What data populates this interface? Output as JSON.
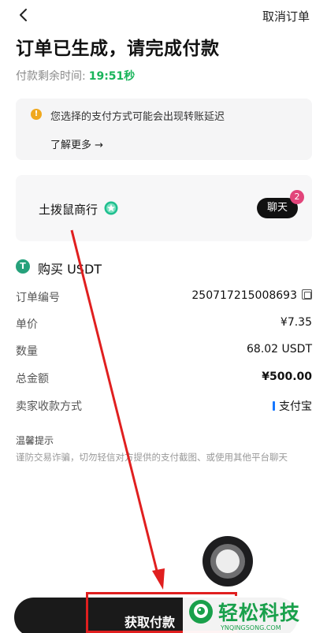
{
  "nav": {
    "cancel_label": "取消订单"
  },
  "header": {
    "title": "订单已生成，请完成付款",
    "timer_label": "付款剩余时间:",
    "timer_value": "19:51秒"
  },
  "notice": {
    "message": "您选择的支付方式可能会出现转账延迟",
    "link_label": "了解更多 →"
  },
  "seller": {
    "name": "土拨鼠商行",
    "chat_label": "聊天",
    "chat_badge": "2"
  },
  "order": {
    "heading": "购买 USDT",
    "coin_symbol": "T",
    "rows": [
      {
        "label": "订单编号",
        "value": "250717215008693"
      },
      {
        "label": "单价",
        "value": "¥7.35"
      },
      {
        "label": "数量",
        "value": "68.02 USDT"
      },
      {
        "label": "总金额",
        "value": "¥500.00"
      },
      {
        "label": "卖家收款方式",
        "value": "支付宝"
      }
    ]
  },
  "tips": {
    "title": "温馨提示",
    "text": "谨防交易诈骗，切勿轻信对方提供的支付截图、或使用其他平台聊天"
  },
  "action": {
    "button_label": "获取付款"
  },
  "watermark": {
    "name": "轻松科技",
    "site": "YNQINGSONG.COM"
  },
  "colors": {
    "timer_green": "#18b45a",
    "warning": "#f0a81e",
    "badge_pink": "#e2447a",
    "tether_green": "#26a17b",
    "alipay_blue": "#1677ff",
    "annotation_red": "#e01f1f"
  }
}
